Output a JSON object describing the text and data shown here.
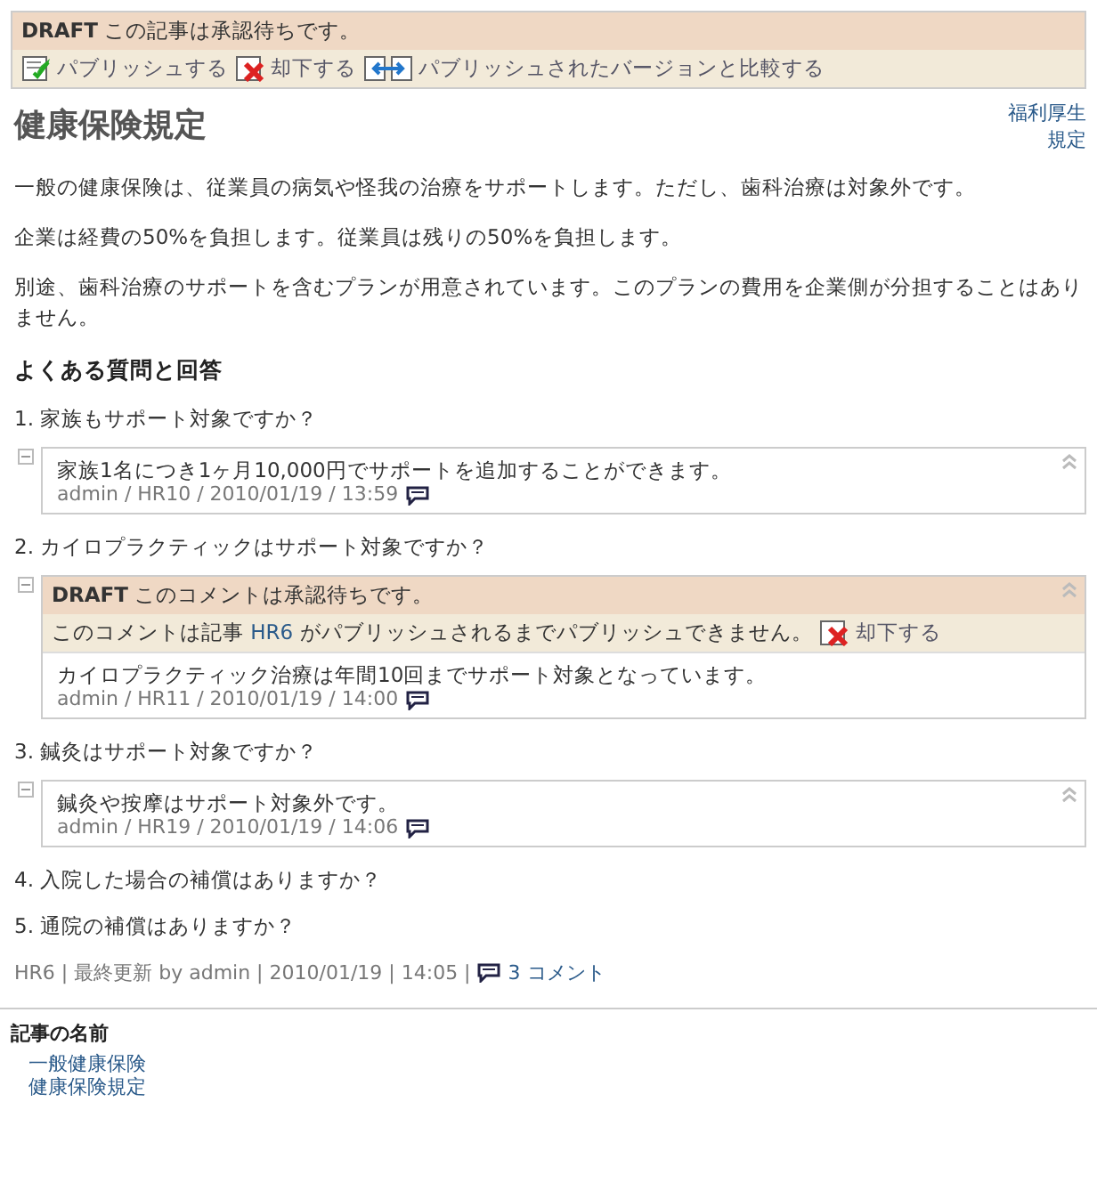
{
  "draft_banner": {
    "label": "DRAFT",
    "message": "この記事は承認待ちです。",
    "actions": [
      {
        "kind": "publish",
        "label": "パブリッシュする"
      },
      {
        "kind": "reject",
        "label": "却下する"
      },
      {
        "kind": "compare",
        "label": "パブリッシュされたバージョンと比較する"
      }
    ]
  },
  "article": {
    "title": "健康保険規定",
    "tags": [
      "福利厚生",
      "規定"
    ],
    "paragraphs": [
      "一般の健康保険は、従業員の病気や怪我の治療をサポートします。ただし、歯科治療は対象外です。",
      "企業は経費の50%を負担します。従業員は残りの50%を負担します。",
      "別途、歯科治療のサポートを含むプランが用意されています。このプランの費用を企業側が分担することはありません。"
    ],
    "faq_heading": "よくある質問と回答",
    "questions": [
      {
        "text": "1. 家族もサポート対象ですか？",
        "comment": {
          "text": "家族1名につき1ヶ月10,000円でサポートを追加することができます。",
          "meta": "admin / HR10 / 2010/01/19 / 13:59"
        }
      },
      {
        "text": "2. カイロプラクティックはサポート対象ですか？",
        "comment": {
          "draft": {
            "label": "DRAFT",
            "message": "このコメントは承認待ちです。",
            "note_before": "このコメントは記事",
            "note_link": "HR6",
            "note_after": "がパブリッシュされるまでパブリッシュできません。",
            "action": "却下する"
          },
          "text": "カイロプラクティック治療は年間10回までサポート対象となっています。",
          "meta": "admin / HR11 / 2010/01/19 / 14:00"
        }
      },
      {
        "text": "3. 鍼灸はサポート対象ですか？",
        "comment": {
          "text": "鍼灸や按摩はサポート対象外です。",
          "meta": "admin / HR19 / 2010/01/19 / 14:06"
        }
      },
      {
        "text": "4. 入院した場合の補償はありますか？"
      },
      {
        "text": "5. 通院の補償はありますか？"
      }
    ],
    "footer": {
      "meta": "HR6 | 最終更新 by admin | 2010/01/19 | 14:05 |",
      "comments": "3 コメント"
    }
  },
  "related": {
    "heading": "記事の名前",
    "links": [
      "一般健康保険",
      "健康保険規定"
    ]
  }
}
